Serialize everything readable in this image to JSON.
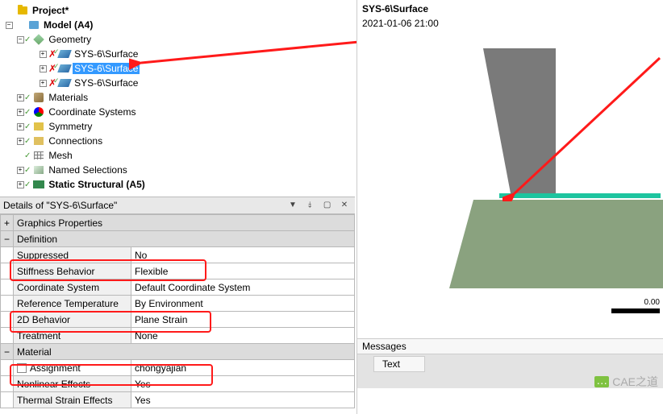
{
  "tree": {
    "root": "Project*",
    "model": "Model (A4)",
    "geometry": "Geometry",
    "surface1": "SYS-6\\Surface",
    "surface2": "SYS-6\\Surface",
    "surface3": "SYS-6\\Surface",
    "materials": "Materials",
    "coord_sys": "Coordinate Systems",
    "symmetry": "Symmetry",
    "connections": "Connections",
    "mesh": "Mesh",
    "named_selections": "Named Selections",
    "static_structural": "Static Structural (A5)"
  },
  "details": {
    "title": "Details of \"SYS-6\\Surface\"",
    "sections": {
      "graphics": "Graphics Properties",
      "definition": "Definition",
      "material": "Material"
    },
    "rows": {
      "suppressed": {
        "label": "Suppressed",
        "value": "No"
      },
      "stiffness_behavior": {
        "label": "Stiffness Behavior",
        "value": "Flexible"
      },
      "coord_sys": {
        "label": "Coordinate System",
        "value": "Default Coordinate System"
      },
      "ref_temp": {
        "label": "Reference Temperature",
        "value": "By Environment"
      },
      "behavior_2d": {
        "label": "2D Behavior",
        "value": "Plane Strain"
      },
      "treatment": {
        "label": "Treatment",
        "value": "None"
      },
      "assignment": {
        "label": "Assignment",
        "value": "chongyajian"
      },
      "nonlinear": {
        "label": "Nonlinear Effects",
        "value": "Yes"
      },
      "thermal_strain": {
        "label": "Thermal Strain Effects",
        "value": "Yes"
      }
    }
  },
  "viewer": {
    "title": "SYS-6\\Surface",
    "timestamp": "2021-01-06 21:00",
    "scale_value": "0.00"
  },
  "messages": {
    "title": "Messages",
    "col1": "",
    "col2": "Text"
  },
  "watermark": "CAE之道"
}
